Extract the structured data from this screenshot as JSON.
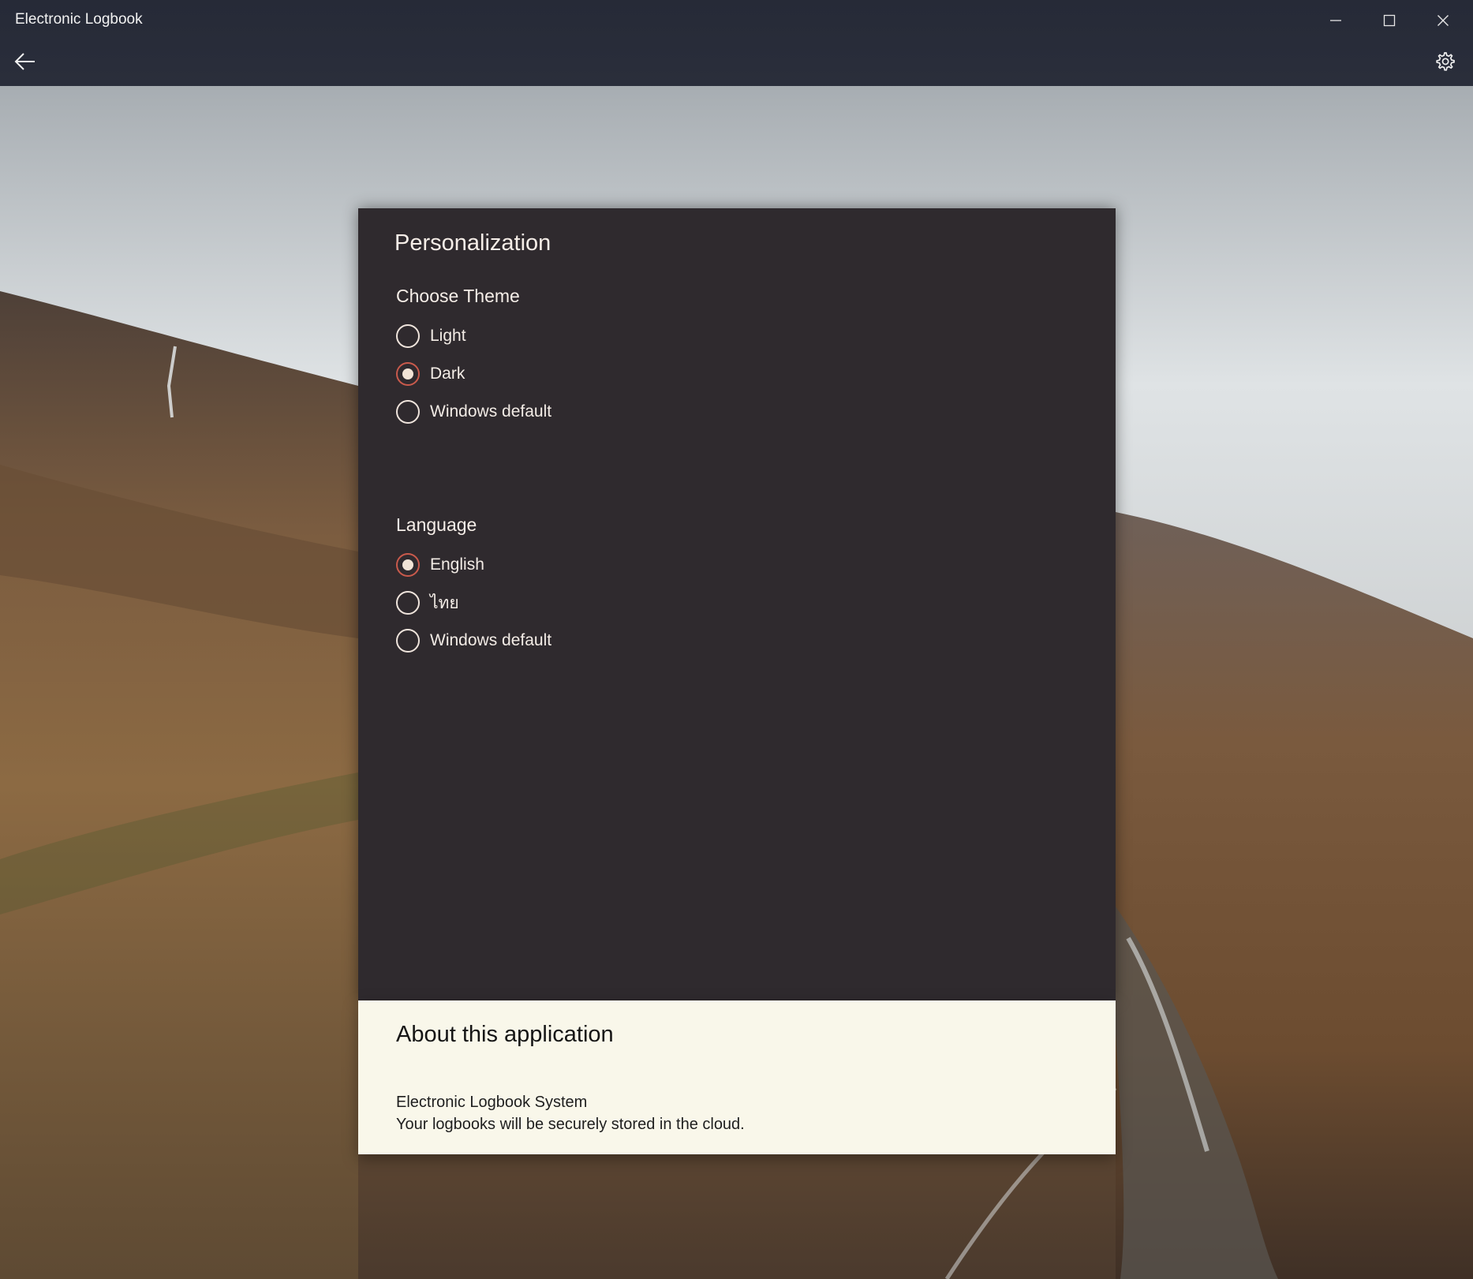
{
  "window": {
    "title": "Electronic Logbook"
  },
  "icons": {
    "minimize": "minimize-icon",
    "maximize": "maximize-icon",
    "close": "close-icon",
    "back": "back-arrow-icon",
    "settings": "gear-icon"
  },
  "colors": {
    "panel_background": "#2f2a2e",
    "about_background": "#f9f7ea",
    "accent": "#c95a4c",
    "titlebar": "#2a2e3b"
  },
  "personalization": {
    "title": "Personalization",
    "theme": {
      "heading": "Choose Theme",
      "options": [
        {
          "label": "Light",
          "selected": false
        },
        {
          "label": "Dark",
          "selected": true
        },
        {
          "label": "Windows default",
          "selected": false
        }
      ]
    },
    "language": {
      "heading": "Language",
      "options": [
        {
          "label": "English",
          "selected": true
        },
        {
          "label": "ไทย",
          "selected": false
        },
        {
          "label": "Windows default",
          "selected": false
        }
      ]
    }
  },
  "about": {
    "title": "About this application",
    "line1": "Electronic Logbook System",
    "line2": "Your logbooks will be securely stored in the cloud."
  }
}
